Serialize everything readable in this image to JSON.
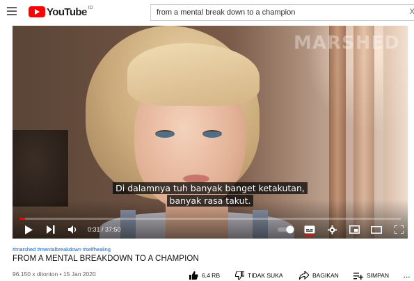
{
  "header": {
    "logo_text": "YouTube",
    "logo_region": "ID",
    "search_value": "from a mental break down to a champion",
    "clear_glyph": "X"
  },
  "player": {
    "watermark": "MARSHED",
    "caption_line1": "Di dalamnya tuh banyak banget ketakutan,",
    "caption_line2": "banyak rasa takut.",
    "time_current": "0:31",
    "time_total": "37:50",
    "time_display": "0:31 / 37:50",
    "progress_fraction": 0.0137,
    "accent_color": "#ff0000"
  },
  "video": {
    "hashtags": "#marshed #mentalbreakdown #selfhealing",
    "title": "FROM A MENTAL BREAKDOWN TO A CHAMPION",
    "meta": "96.150 x ditonton • 15 Jan 2020",
    "actions": {
      "like_count": "6,4 RB",
      "dislike_label": "TIDAK SUKA",
      "share_label": "BAGIKAN",
      "save_label": "SIMPAN",
      "more_glyph": "..."
    }
  },
  "icons": [
    "menu-icon",
    "youtube-logo-icon",
    "play-icon",
    "next-icon",
    "volume-icon",
    "autoplay-toggle-icon",
    "captions-icon",
    "settings-icon",
    "miniplayer-icon",
    "theater-icon",
    "fullscreen-icon",
    "thumbs-up-icon",
    "thumbs-down-icon",
    "share-icon",
    "save-playlist-icon",
    "more-icon"
  ]
}
